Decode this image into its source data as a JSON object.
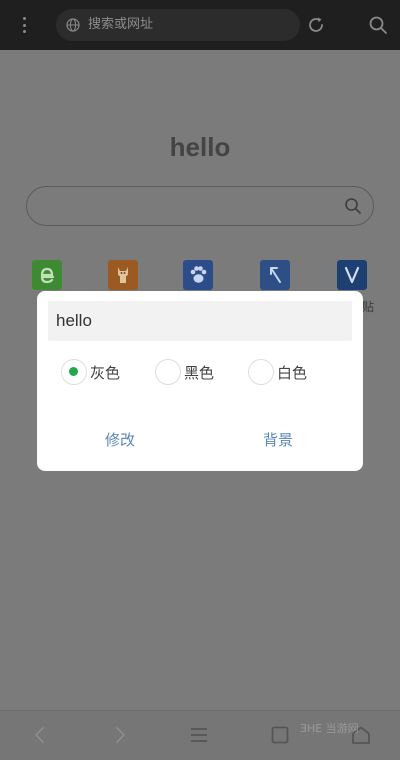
{
  "topbar": {
    "url_placeholder": "搜索或网址",
    "icons": [
      "more-vertical-icon",
      "globe-icon",
      "refresh-icon",
      "search-icon"
    ]
  },
  "home": {
    "title": "hello",
    "shortcuts": [
      {
        "icon": "e-icon",
        "color": "#3d8a33"
      },
      {
        "icon": "alpaca-icon",
        "color": "#9a5a22"
      },
      {
        "icon": "paw-icon",
        "color": "#2d4d8a"
      },
      {
        "icon": "arrow-icon",
        "color": "#2e4f86"
      },
      {
        "icon": "v-icon",
        "color": "#1e3f72"
      }
    ],
    "shortcut_partial_label": "贴"
  },
  "dialog": {
    "input_value": "hello",
    "options": [
      "灰色",
      "黑色",
      "白色"
    ],
    "selected": "灰色",
    "modify_label": "修改",
    "background_label": "背景",
    "accent_color": "#20a84a",
    "button_color": "#5b87b6"
  },
  "bottombar": {
    "icons": [
      "back-icon",
      "forward-icon",
      "menu-icon",
      "tabs-icon",
      "home-icon"
    ]
  },
  "watermark": "ƎHE 当游网"
}
